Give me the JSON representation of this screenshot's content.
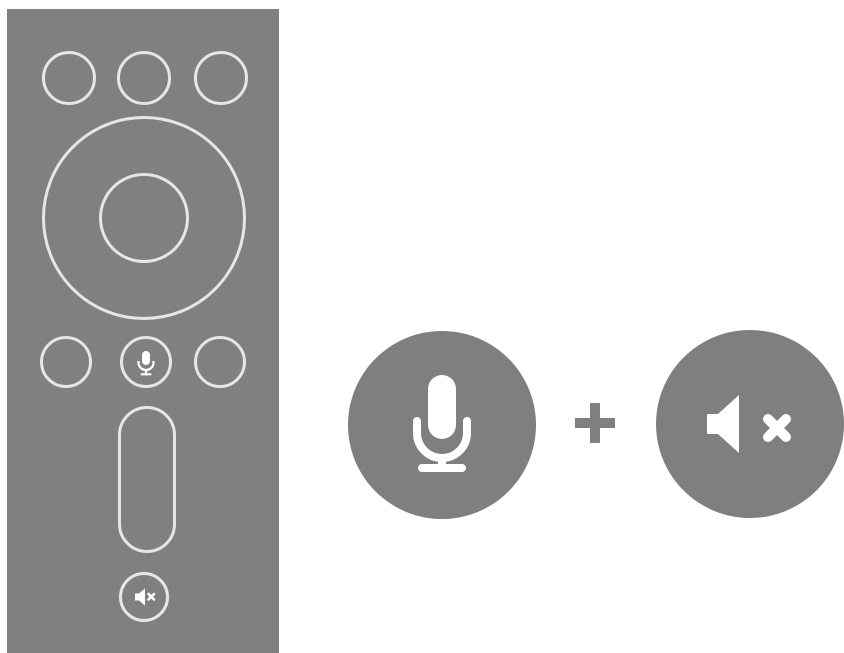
{
  "diagram": {
    "remote": {
      "top_buttons": [
        "button-left",
        "button-center",
        "button-right"
      ],
      "dpad": "navigation-ring",
      "center_button": "ok",
      "middle_row": [
        "button-left",
        "mic-button",
        "button-right"
      ],
      "volume_control": "volume-rocker",
      "bottom_button": "mute"
    },
    "combination": {
      "first_key_icon": "microphone-icon",
      "operator_icon": "plus-icon",
      "second_key_icon": "mute-icon"
    },
    "colors": {
      "remote_body": "#808080",
      "outline": "#e6e6e6",
      "icon_circle": "#7f7f7f",
      "icon_fill": "#ffffff",
      "plus": "#808080"
    }
  }
}
